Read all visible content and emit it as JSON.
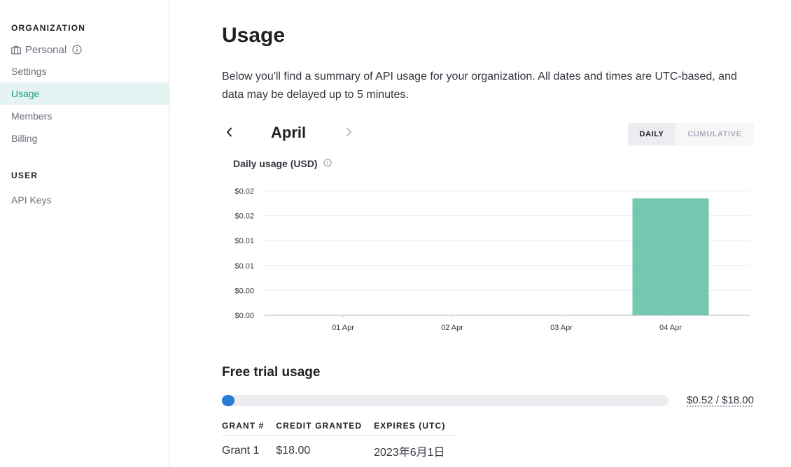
{
  "sidebar": {
    "org_heading": "ORGANIZATION",
    "org_name": "Personal",
    "items": [
      {
        "label": "Settings"
      },
      {
        "label": "Usage",
        "active": true
      },
      {
        "label": "Members"
      },
      {
        "label": "Billing"
      }
    ],
    "user_heading": "USER",
    "user_items": [
      {
        "label": "API Keys"
      }
    ]
  },
  "main": {
    "title": "Usage",
    "description": "Below you'll find a summary of API usage for your organization. All dates and times are UTC-based, and data may be delayed up to 5 minutes.",
    "month": "April",
    "toggle": {
      "daily": "DAILY",
      "cumulative": "CUMULATIVE",
      "selected": "daily"
    },
    "chart_title": "Daily usage (USD)"
  },
  "chart_data": {
    "type": "bar",
    "title": "Daily usage (USD)",
    "categories": [
      "01 Apr",
      "02 Apr",
      "03 Apr",
      "04 Apr"
    ],
    "values": [
      0,
      0,
      0,
      0.0235
    ],
    "ylim": [
      0,
      0.025
    ],
    "y_ticks": [
      0,
      0.005,
      0.01,
      0.015,
      0.02,
      0.025
    ],
    "y_tick_labels": [
      "$0.00",
      "$0.00",
      "$0.01",
      "$0.01",
      "$0.02",
      "$0.02"
    ],
    "grid": true,
    "bar_color": "#74c7b0"
  },
  "free_trial": {
    "title": "Free trial usage",
    "used": 0.52,
    "total": 18.0,
    "amount_label": "$0.52 / $18.00",
    "bar_color": "#2a7bd6",
    "columns": [
      "GRANT #",
      "CREDIT GRANTED",
      "EXPIRES (UTC)"
    ],
    "rows": [
      [
        "Grant 1",
        "$18.00",
        "2023年6月1日"
      ]
    ]
  }
}
